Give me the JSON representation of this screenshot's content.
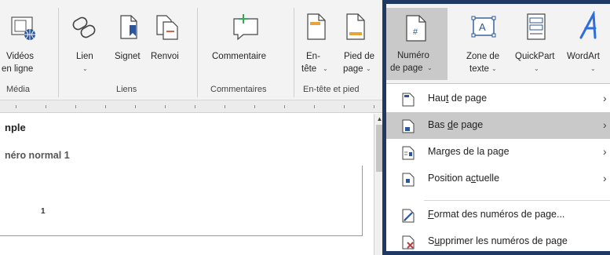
{
  "ribbon": {
    "media": {
      "btn1_l1": "Vidéos",
      "btn1_l2": "en ligne",
      "group": "Média"
    },
    "links": {
      "lien_l1": "Lien",
      "signet": "Signet",
      "renvoi": "Renvoi",
      "group": "Liens"
    },
    "comments": {
      "commentaire": "Commentaire",
      "group": "Commentaires"
    },
    "header_footer": {
      "entete_l1": "En-",
      "entete_l2": "tête",
      "pied_l1": "Pied de",
      "pied_l2": "page",
      "numero_l1": "Numéro",
      "numero_l2": "de page",
      "group": "En-tête et pied"
    },
    "text": {
      "zone_l1": "Zone de",
      "zone_l2": "texte",
      "quickpart": "QuickPart",
      "wordart": "WordArt"
    }
  },
  "document": {
    "heading": "nple",
    "style_label": "néro normal 1",
    "page_number": "1"
  },
  "menu": {
    "items": [
      {
        "label_pre": "Hau",
        "label_u": "t",
        "label_post": " de page",
        "icon": "page-top-icon",
        "submenu": true
      },
      {
        "label_pre": "Bas ",
        "label_u": "d",
        "label_post": "e page",
        "icon": "page-bottom-icon",
        "submenu": true
      },
      {
        "label_pre": "Mar",
        "label_u": "g",
        "label_post": "es de la page",
        "icon": "page-margins-icon",
        "submenu": true
      },
      {
        "label_pre": "Position a",
        "label_u": "c",
        "label_post": "tuelle",
        "icon": "current-position-icon",
        "submenu": true
      },
      {
        "label_pre": "",
        "label_u": "F",
        "label_post": "ormat des numéros de page...",
        "icon": "format-page-numbers-icon",
        "submenu": false
      },
      {
        "label_pre": "S",
        "label_u": "u",
        "label_post": "pprimer les numéros de page",
        "icon": "remove-page-numbers-icon",
        "submenu": false
      }
    ],
    "submenu_arrow": "›"
  },
  "colors": {
    "frame": "#1f3864",
    "accent_blue": "#2b579a",
    "highlight": "#c9c9c9",
    "comment_green": "#3aa657",
    "wordart_blue": "#2f6fdb",
    "remove_red": "#d13438"
  }
}
